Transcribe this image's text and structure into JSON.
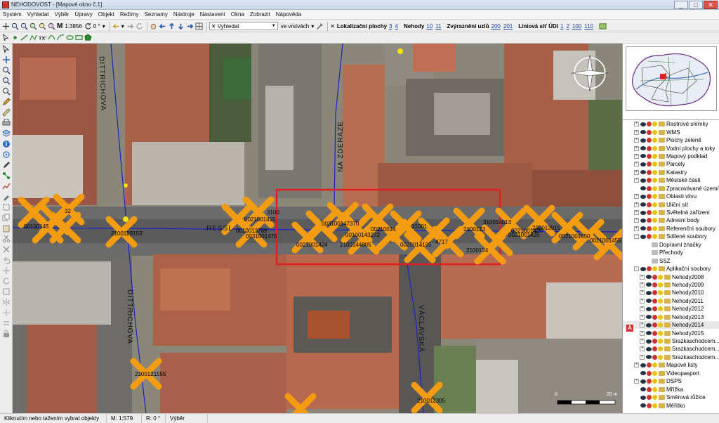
{
  "window": {
    "title": "NEHODOVOST - [Mapové okno č.1]",
    "controls": [
      "_",
      "□",
      "✕"
    ]
  },
  "menu": [
    "Systém",
    "Vyhledat",
    "Výběr",
    "Úpravy",
    "Objekt",
    "Režimy",
    "Seznamy",
    "Nástroje",
    "Nastavení",
    "Okna",
    "Zobrazit",
    "Nápověda"
  ],
  "toolbar": {
    "scale_prefix": "M",
    "scale": "1:3856",
    "rotation": "0 °",
    "search_label": "Vyhledat",
    "search_scope": "ve vrstvách",
    "lokalizacni_label": "Lokalizační plochy",
    "lokalizacni_links": [
      "3",
      "4"
    ],
    "nehody_label": "Nehody",
    "nehody_links": [
      "10",
      "11"
    ],
    "zvyrazneni_label": "Zvýraznění uzlů",
    "zvyrazneni_links": [
      "200",
      "201"
    ],
    "liniova_label": "Liniová síť ÚDI",
    "liniova_links": [
      "1",
      "2",
      "100",
      "110"
    ]
  },
  "map": {
    "streets": {
      "dittrichova_top": "DITTRICHOVA",
      "dittrichova_bottom": "DITTRICHOVA",
      "na_zderaze": "NA ZDERAZE",
      "ressl": "RESSL",
      "vaclavska": "VÁCLAVSKÁ"
    },
    "node_labels": [
      "00100145",
      "32",
      "2100129153",
      "0010013789",
      "0031001475",
      "0021001415",
      "3100",
      "0021001424",
      "003100147370",
      "2100144805",
      "00100143272",
      "00210014",
      "0020014195",
      "4717",
      "31001",
      "2100123",
      "310014013",
      "0021001425",
      "2100124",
      "0021001425",
      "210013915",
      "0021001450",
      "0021001455",
      "2100121555",
      "210012305"
    ],
    "scale_bar": [
      "0",
      "20 m"
    ],
    "compass_letters": [
      "S",
      "J"
    ],
    "colors": {
      "accident_marker": "#f39c12",
      "selection_box": "#e02020",
      "street_line": "#1a22c8",
      "node_point": "#f5e400"
    }
  },
  "overview": {
    "district_label": "1"
  },
  "layers": [
    {
      "name": "Rastrové snímky",
      "expander": "+",
      "icons": "eye-red-yellow-folder"
    },
    {
      "name": "WMS",
      "expander": "+",
      "icons": "eye-red-yellow-folder"
    },
    {
      "name": "Plochy zeleně",
      "expander": "+",
      "icons": "eye-red-yellow-folder"
    },
    {
      "name": "Vodní plochy a toky",
      "expander": "+",
      "icons": "eye-red-yellow-folder"
    },
    {
      "name": "Mapový podklad",
      "expander": "+",
      "icons": "eye-red-yellow-folder"
    },
    {
      "name": "Parcely",
      "expander": "+",
      "icons": "eye-red-yellow-folder"
    },
    {
      "name": "Katastry",
      "expander": "+",
      "icons": "eye-red-yellow-folder"
    },
    {
      "name": "Městské části",
      "expander": "+",
      "icons": "eye-red-yellow-folder"
    },
    {
      "name": "Zpracovávané území",
      "expander": "",
      "icons": "eye-red-yellow-folder"
    },
    {
      "name": "Oblasti vlivu",
      "expander": "+",
      "icons": "eye-red-yellow-folder"
    },
    {
      "name": "Uliční síť",
      "expander": "+",
      "icons": "eye-red-yellow-folder"
    },
    {
      "name": "Světelná zařízení",
      "expander": "+",
      "icons": "eye-red-yellow-folder"
    },
    {
      "name": "Adresní body",
      "expander": "+",
      "icons": "eye-red-yellow-folder"
    },
    {
      "name": "Referenční soubory",
      "expander": "+",
      "icons": "eye-red-yellow-folder"
    },
    {
      "name": "Sdílené soubory",
      "expander": "-",
      "icons": "eye-red-yellow-folder"
    },
    {
      "name": "Dopravní značky",
      "expander": "",
      "indent": 2,
      "icons": "folder"
    },
    {
      "name": "Přechody",
      "expander": "",
      "indent": 2,
      "icons": "folder"
    },
    {
      "name": "SSZ",
      "expander": "",
      "indent": 2,
      "icons": "folder"
    },
    {
      "name": "Aplikační soubory",
      "expander": "-",
      "icons": "eye-red-yellow-folder"
    },
    {
      "name": "Nehody2008",
      "expander": "+",
      "indent": 1,
      "icons": "eye-red-yellow-folder"
    },
    {
      "name": "Nehody2009",
      "expander": "+",
      "indent": 1,
      "icons": "eye-red-yellow-folder"
    },
    {
      "name": "Nehody2010",
      "expander": "+",
      "indent": 1,
      "icons": "eye-red-yellow-folder"
    },
    {
      "name": "Nehody2011",
      "expander": "+",
      "indent": 1,
      "icons": "eye-red-yellow-folder"
    },
    {
      "name": "Nehody2012",
      "expander": "+",
      "indent": 1,
      "icons": "eye-red-yellow-folder"
    },
    {
      "name": "Nehody2013",
      "expander": "+",
      "indent": 1,
      "icons": "eye-red-yellow-folder"
    },
    {
      "name": "Nehody2014",
      "expander": "+",
      "indent": 1,
      "icons": "eye-red-yellow-folder",
      "selected": true
    },
    {
      "name": "Nehody2015",
      "expander": "+",
      "indent": 1,
      "icons": "eye-red-yellow-folder"
    },
    {
      "name": "Srazkaschodcem...",
      "expander": "+",
      "indent": 1,
      "icons": "eye-red-yellow-folder"
    },
    {
      "name": "Srazkaschodcem...",
      "expander": "+",
      "indent": 1,
      "icons": "eye-red-yellow-folder"
    },
    {
      "name": "Srazkaschodcem...",
      "expander": "+",
      "indent": 1,
      "icons": "eye-red-yellow-folder"
    },
    {
      "name": "Mapové listy",
      "expander": "+",
      "icons": "eye-red-yellow-folder"
    },
    {
      "name": "Videopasport",
      "expander": "",
      "icons": "eye-red-yellow-folder"
    },
    {
      "name": "DSPS",
      "expander": "+",
      "icons": "eye-red-yellow-folder"
    },
    {
      "name": "Mřížka",
      "expander": "",
      "icons": "eye-red-yellow-folder"
    },
    {
      "name": "Směrová růžice",
      "expander": "",
      "icons": "eye-red-yellow-folder"
    },
    {
      "name": "Měřítko",
      "expander": "",
      "icons": "eye-red-yellow-folder"
    }
  ],
  "layer_marker": "A",
  "status": {
    "hint": "Kliknutím nebo tažením vybrat objekty",
    "scale": "M: 1:579",
    "rotation": "R: 0 °",
    "mode": "Výběr"
  }
}
